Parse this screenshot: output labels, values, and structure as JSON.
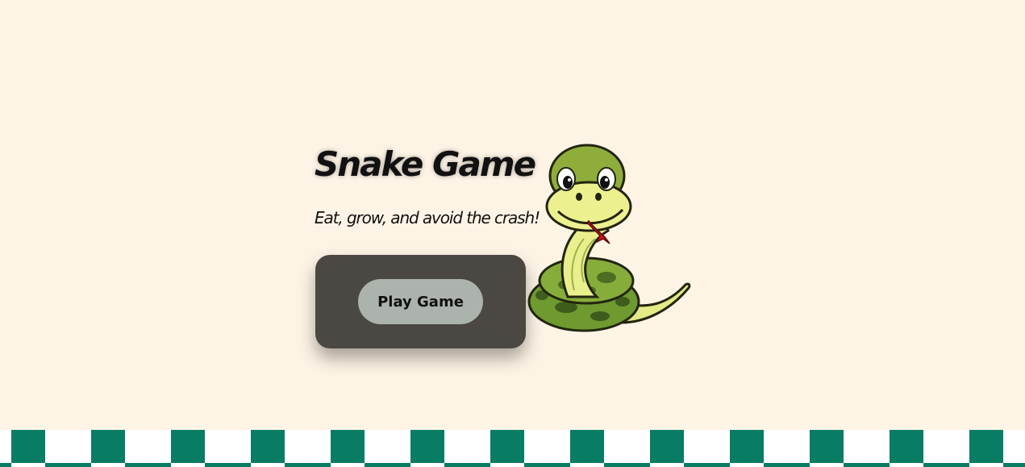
{
  "game": {
    "title": "Snake Game",
    "tagline": "Eat, grow, and avoid the crash!",
    "play_button_label": "Play Game"
  },
  "colors": {
    "background": "#fef4e6",
    "panel": "#4b4742",
    "button": "#abb3ac",
    "checker_green": "#097c64",
    "checker_white": "#ffffff"
  },
  "icons": {
    "mascot": "snake-mascot-icon"
  }
}
